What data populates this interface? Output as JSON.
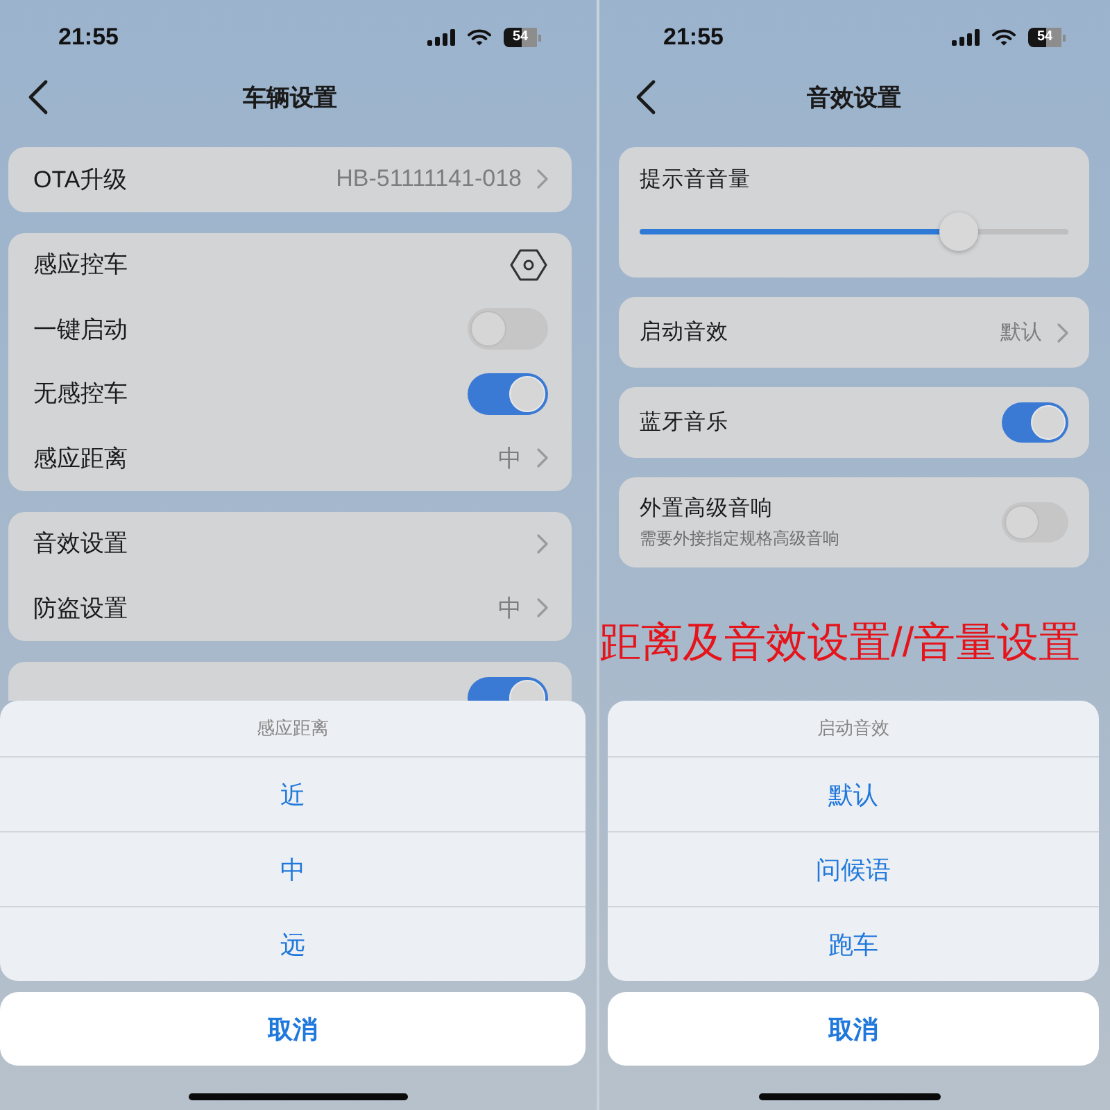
{
  "phones": [
    {
      "status_bar": {
        "time": "21:55",
        "battery": "54"
      },
      "nav": {
        "title": "车辆设置"
      },
      "groups": [
        {
          "rows": [
            {
              "kind": "nav",
              "label": "OTA升级",
              "value": "HB-51111141-018"
            }
          ]
        },
        {
          "rows": [
            {
              "kind": "icon",
              "label": "感应控车"
            },
            {
              "kind": "toggle",
              "label": "一键启动",
              "on": false
            },
            {
              "kind": "toggle",
              "label": "无感控车",
              "on": true
            },
            {
              "kind": "nav",
              "label": "感应距离",
              "value": "中"
            }
          ]
        },
        {
          "rows": [
            {
              "kind": "nav",
              "label": "音效设置"
            },
            {
              "kind": "nav",
              "label": "防盗设置",
              "value": "中"
            }
          ]
        },
        {
          "clipped": true,
          "rows": [
            {
              "kind": "toggle",
              "on": true
            }
          ]
        }
      ],
      "sheet": {
        "title": "感应距离",
        "options": [
          "近",
          "中",
          "远"
        ],
        "cancel": "取消"
      }
    },
    {
      "status_bar": {
        "time": "21:55",
        "battery": "54"
      },
      "nav": {
        "title": "音效设置"
      },
      "groups": [
        {
          "rows": [
            {
              "kind": "slider",
              "label": "提示音音量",
              "level": 0.77
            }
          ]
        },
        {
          "rows": [
            {
              "kind": "nav",
              "label": "启动音效",
              "value": "默认"
            }
          ]
        },
        {
          "rows": [
            {
              "kind": "toggle",
              "label": "蓝牙音乐",
              "on": true
            }
          ]
        },
        {
          "rows": [
            {
              "kind": "toggle",
              "label": "外置高级音响",
              "sublabel": "需要外接指定规格高级音响",
              "on": false
            }
          ]
        }
      ],
      "caption": "距离及音效设置//音量设置",
      "sheet": {
        "title": "启动音效",
        "options": [
          "默认",
          "问候语",
          "跑车"
        ],
        "cancel": "取消"
      }
    }
  ]
}
